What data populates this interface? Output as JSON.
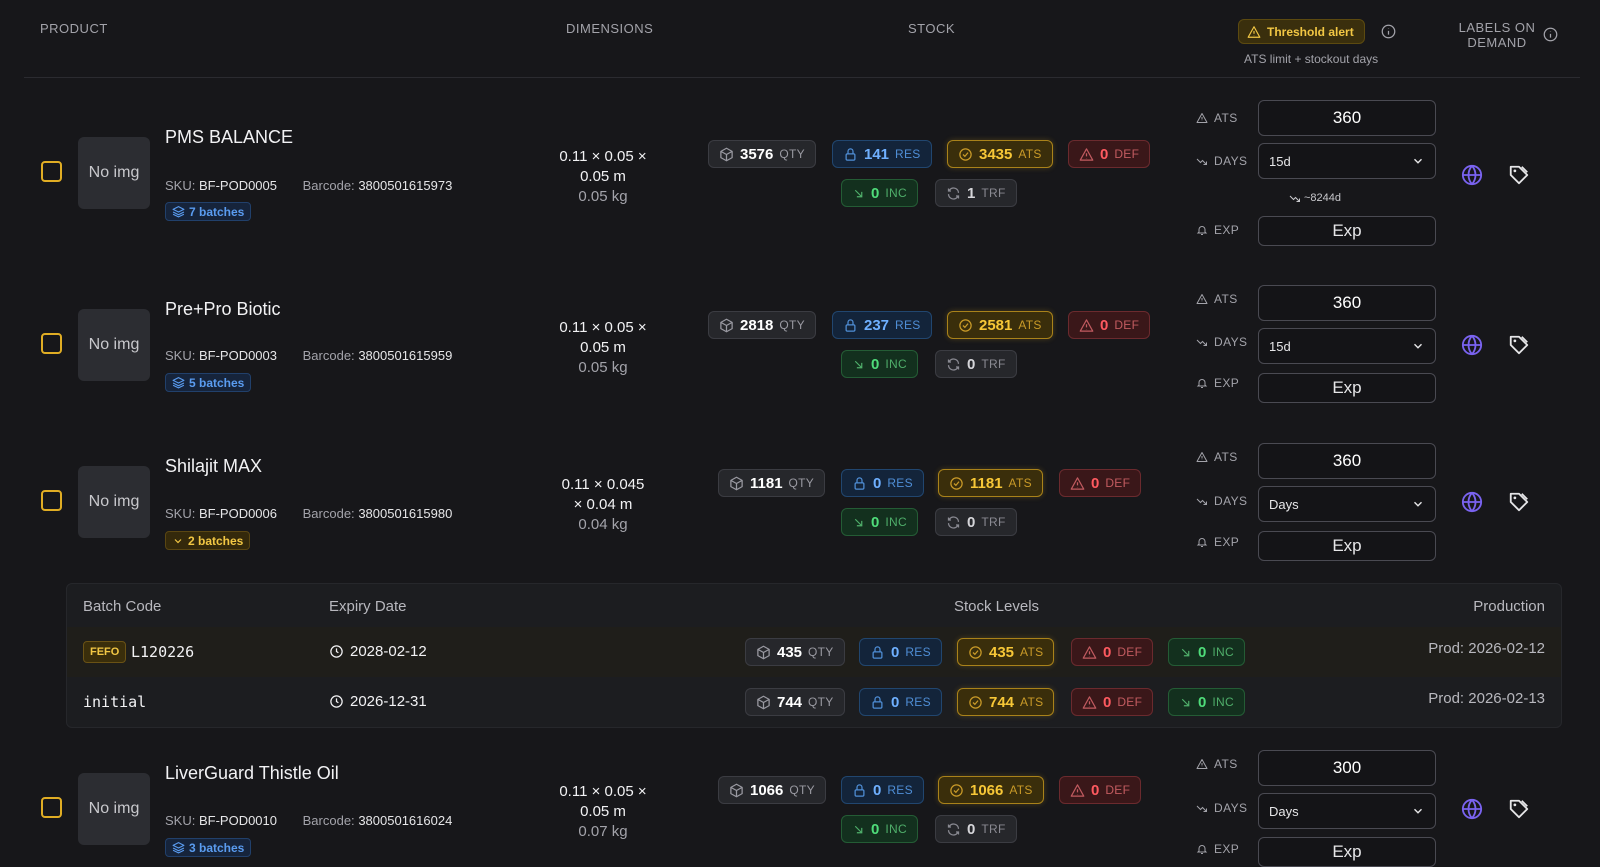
{
  "header": {
    "product": "PRODUCT",
    "dimensions": "DIMENSIONS",
    "stock": "STOCK",
    "threshold_alert": "Threshold alert",
    "ats_subtitle": "ATS limit + stockout days",
    "labels_on_demand": "LABELS ON DEMAND"
  },
  "labels": {
    "no_img": "No img",
    "sku": "SKU:",
    "barcode": "Barcode:",
    "qty": "QTY",
    "res": "RES",
    "ats": "ATS",
    "def": "DEF",
    "inc": "INC",
    "trf": "TRF",
    "field_ats": "ATS",
    "field_days": "DAYS",
    "field_exp": "EXP",
    "exp_button": "Exp"
  },
  "products": [
    {
      "name": "PMS BALANCE",
      "sku": "BF-POD0005",
      "barcode": "3800501615973",
      "batches": "7 batches",
      "dims_line1": "0.11 × 0.05 ×",
      "dims_line2": "0.05 m",
      "weight": "0.05 kg",
      "qty": "3576",
      "res": "141",
      "ats": "3435",
      "def": "0",
      "inc": "0",
      "trf": "1",
      "ats_limit": "360",
      "days": "15d",
      "stockout": "~8244d"
    },
    {
      "name": "Pre+Pro Biotic",
      "sku": "BF-POD0003",
      "barcode": "3800501615959",
      "batches": "5 batches",
      "dims_line1": "0.11 × 0.05 ×",
      "dims_line2": "0.05 m",
      "weight": "0.05 kg",
      "qty": "2818",
      "res": "237",
      "ats": "2581",
      "def": "0",
      "inc": "0",
      "trf": "0",
      "ats_limit": "360",
      "days": "15d"
    },
    {
      "name": "Shilajit MAX",
      "sku": "BF-POD0006",
      "barcode": "3800501615980",
      "batches": "2 batches",
      "dims_line1": "0.11 × 0.045",
      "dims_line2": "× 0.04 m",
      "weight": "0.04 kg",
      "qty": "1181",
      "res": "0",
      "ats": "1181",
      "def": "0",
      "inc": "0",
      "trf": "0",
      "ats_limit": "360",
      "days": "Days"
    },
    {
      "name": "LiverGuard Thistle Oil",
      "sku": "BF-POD0010",
      "barcode": "3800501616024",
      "batches": "3 batches",
      "dims_line1": "0.11 × 0.05 ×",
      "dims_line2": "0.05 m",
      "weight": "0.07 kg",
      "qty": "1066",
      "res": "0",
      "ats": "1066",
      "def": "0",
      "inc": "0",
      "trf": "0",
      "ats_limit": "300",
      "days": "Days"
    }
  ],
  "batch_table": {
    "headers": {
      "batch_code": "Batch Code",
      "expiry_date": "Expiry Date",
      "stock_levels": "Stock Levels",
      "production": "Production"
    },
    "fefo_badge": "FEFO",
    "rows": [
      {
        "code": "L120226",
        "expiry": "2028-02-12",
        "qty": "435",
        "res": "0",
        "ats": "435",
        "def": "0",
        "inc": "0",
        "production": "Prod: 2026-02-12"
      },
      {
        "code": "initial",
        "expiry": "2026-12-31",
        "qty": "744",
        "res": "0",
        "ats": "744",
        "def": "0",
        "inc": "0",
        "production": "Prod: 2026-02-13"
      }
    ]
  },
  "colors": {
    "background": "#17171a",
    "accent_gold": "#f2c744",
    "accent_blue": "#5a9cf0",
    "globe_purple": "#7a63f0"
  }
}
